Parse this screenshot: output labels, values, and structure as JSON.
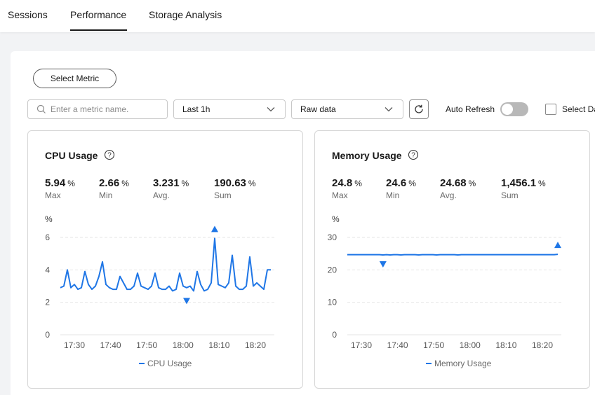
{
  "tabs": [
    {
      "label": "Sessions"
    },
    {
      "label": "Performance",
      "active": true
    },
    {
      "label": "Storage Analysis"
    }
  ],
  "toolbar": {
    "select_metric_label": "Select Metric",
    "search_placeholder": "Enter a metric name.",
    "time_range": "Last 1h",
    "data_mode": "Raw data",
    "auto_refresh_label": "Auto Refresh",
    "auto_refresh_on": false,
    "select_all_label": "Select Da"
  },
  "colors": {
    "series": "#1f76e6",
    "grid": "#e6e6e6",
    "text": "#191919",
    "muted": "#6a6a6a"
  },
  "icons": {
    "search": "search-icon",
    "chevron": "chevron-down-icon",
    "refresh": "refresh-icon",
    "help": "help-circle-icon",
    "max_marker": "triangle-up-icon",
    "min_marker": "triangle-down-icon"
  },
  "cards": [
    {
      "title": "CPU Usage",
      "stats": [
        {
          "value": "5.94",
          "unit": "%",
          "label": "Max"
        },
        {
          "value": "2.66",
          "unit": "%",
          "label": "Min"
        },
        {
          "value": "3.231",
          "unit": "%",
          "label": "Avg."
        },
        {
          "value": "190.63",
          "unit": "%",
          "label": "Sum"
        }
      ],
      "legend": "CPU Usage"
    },
    {
      "title": "Memory Usage",
      "stats": [
        {
          "value": "24.8",
          "unit": "%",
          "label": "Max"
        },
        {
          "value": "24.6",
          "unit": "%",
          "label": "Min"
        },
        {
          "value": "24.68",
          "unit": "%",
          "label": "Avg."
        },
        {
          "value": "1,456.1",
          "unit": "%",
          "label": "Sum"
        }
      ],
      "legend": "Memory Usage"
    }
  ],
  "chart_data": [
    {
      "type": "line",
      "ylabel": "%",
      "ylim": [
        0,
        6
      ],
      "yticks": [
        0,
        2,
        4,
        6
      ],
      "x_ticks": [
        "17:30",
        "17:40",
        "17:50",
        "18:00",
        "18:10",
        "18:20"
      ],
      "grid": true,
      "legend_position": "bottom",
      "series": [
        {
          "name": "CPU Usage",
          "values": [
            2.9,
            3.0,
            4.0,
            2.9,
            3.1,
            2.8,
            2.9,
            3.9,
            3.1,
            2.8,
            3.0,
            3.6,
            4.5,
            3.1,
            2.9,
            2.8,
            2.8,
            3.6,
            3.2,
            2.8,
            2.8,
            3.0,
            3.8,
            3.0,
            2.9,
            2.8,
            3.0,
            3.8,
            2.9,
            2.8,
            2.8,
            3.0,
            2.7,
            2.8,
            3.8,
            3.0,
            2.9,
            3.0,
            2.7,
            3.9,
            3.1,
            2.7,
            2.8,
            3.2,
            5.94,
            3.1,
            3.0,
            2.9,
            3.2,
            4.9,
            3.0,
            2.8,
            2.8,
            3.0,
            4.8,
            3.0,
            3.2,
            3.0,
            2.8,
            4.0,
            4.0
          ]
        }
      ],
      "max": {
        "index": 44,
        "value": 5.94
      },
      "min": {
        "index": 36,
        "value": 2.66
      }
    },
    {
      "type": "line",
      "ylabel": "%",
      "ylim": [
        0,
        30
      ],
      "yticks": [
        0,
        10,
        20,
        30
      ],
      "x_ticks": [
        "17:30",
        "17:40",
        "17:50",
        "18:00",
        "18:10",
        "18:20"
      ],
      "grid": true,
      "legend_position": "bottom",
      "series": [
        {
          "name": "Memory Usage",
          "values": [
            24.7,
            24.7,
            24.7,
            24.7,
            24.7,
            24.7,
            24.7,
            24.7,
            24.7,
            24.7,
            24.6,
            24.7,
            24.6,
            24.7,
            24.7,
            24.6,
            24.7,
            24.7,
            24.7,
            24.7,
            24.6,
            24.7,
            24.7,
            24.7,
            24.7,
            24.6,
            24.7,
            24.7,
            24.7,
            24.7,
            24.7,
            24.6,
            24.7,
            24.7,
            24.7,
            24.7,
            24.7,
            24.7,
            24.7,
            24.7,
            24.7,
            24.7,
            24.7,
            24.7,
            24.7,
            24.7,
            24.7,
            24.7,
            24.7,
            24.7,
            24.7,
            24.7,
            24.7,
            24.7,
            24.7,
            24.7,
            24.7,
            24.7,
            24.7,
            24.8
          ]
        }
      ],
      "max": {
        "index": 59,
        "value": 24.8
      },
      "min": {
        "index": 10,
        "value": 24.6
      }
    }
  ]
}
